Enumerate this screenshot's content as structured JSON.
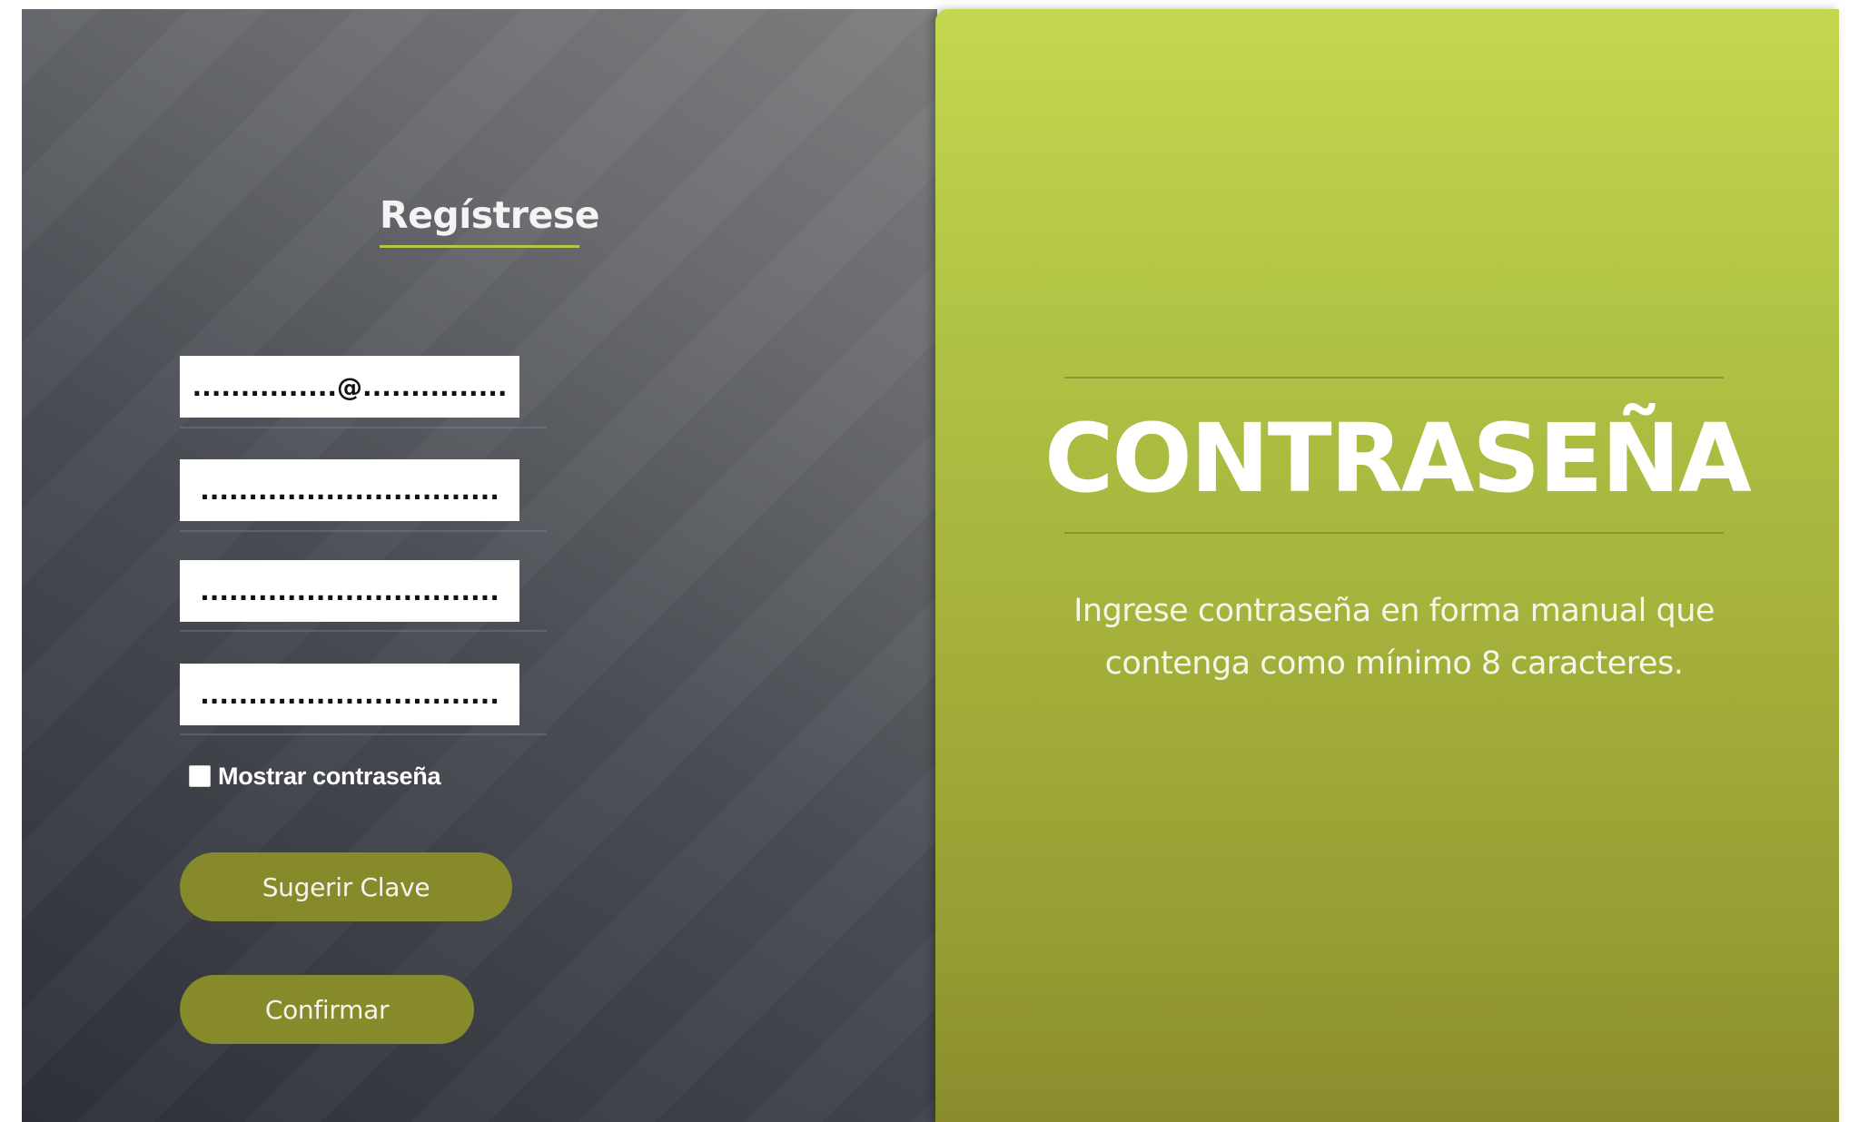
{
  "form": {
    "title": "Regístrese",
    "fields": [
      {
        "value": "...............@..............."
      },
      {
        "value": "..............................."
      },
      {
        "value": "..............................."
      },
      {
        "value": "..............................."
      }
    ],
    "show_password_label": "Mostrar contraseña",
    "show_password_checked": false,
    "suggest_button": "Sugerir Clave",
    "confirm_button": "Confirmar"
  },
  "info_panel": {
    "title": "CONTRASEÑA",
    "description_line1": "Ingrese contraseña en forma manual que",
    "description_line2": "contenga como mínimo 8 caracteres."
  },
  "colors": {
    "accent_green": "#b8c640",
    "button_olive": "#868a2b",
    "panel_green_top": "#c5d650",
    "panel_green_bottom": "#8a8c2c",
    "panel_dark": "#3a3d44"
  }
}
